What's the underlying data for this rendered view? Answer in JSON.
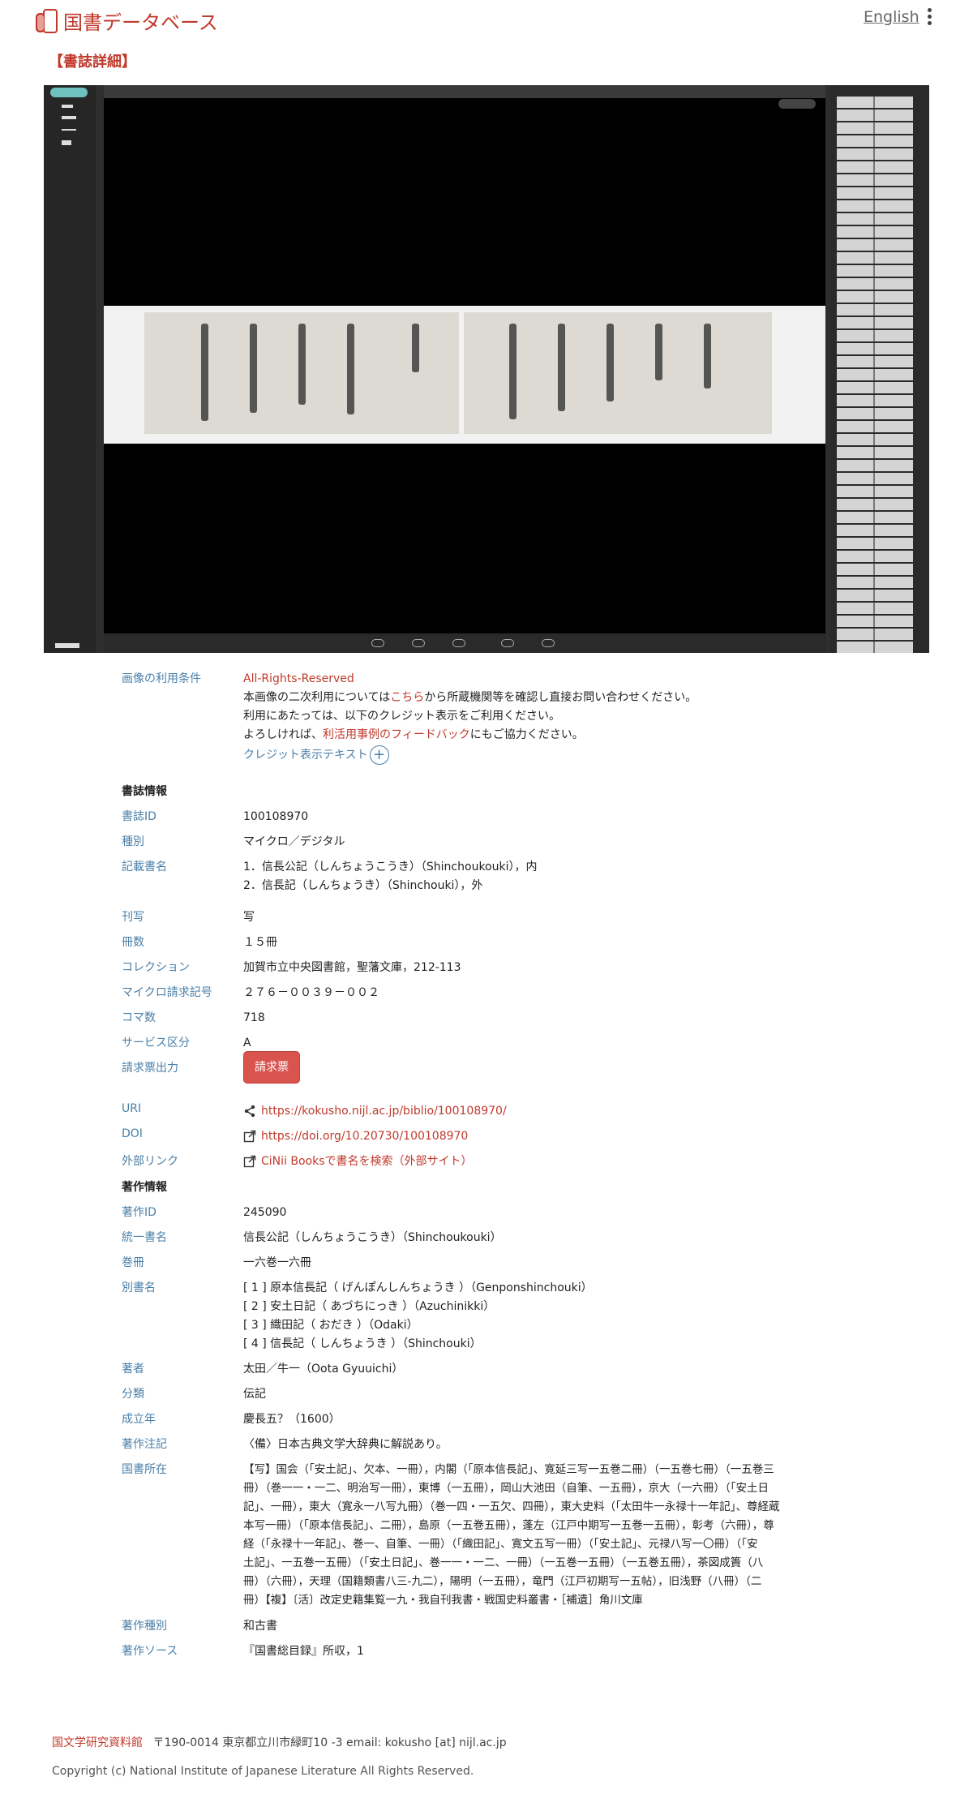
{
  "header": {
    "site_title": "国書データベース",
    "language_link": "English"
  },
  "page_heading": "【書誌詳細】",
  "image_terms": {
    "label": "画像の利用条件",
    "license": "All-Rights-Reserved",
    "line1_pre": "本画像の二次利用については",
    "line1_link": "こちら",
    "line1_post": "から所蔵機関等を確認し直接お問い合わせください。",
    "line2": "利用にあたっては、以下のクレジット表示をご利用ください。",
    "line3_pre": "よろしければ、",
    "line3_link": "利活用事例のフィードバック",
    "line3_post": "にもご協力ください。",
    "credit_toggle": "クレジット表示テキスト"
  },
  "biblio": {
    "section_title": "書誌情報",
    "id_label": "書誌ID",
    "id_value": "100108970",
    "type_label": "種別",
    "type_value": "マイクロ／デジタル",
    "titles_label": "記載書名",
    "title1": "1．信長公記（しんちょうこうき）（Shinchoukouki），内",
    "title2": "2．信長記（しんちょうき）（Shinchouki），外",
    "print_label": "刊写",
    "print_value": "写",
    "volumes_label": "冊数",
    "volumes_value": "１５冊",
    "collection_label": "コレクション",
    "collection_value": "加賀市立中央図書館，聖藩文庫，212‐113",
    "micro_label": "マイクロ請求記号",
    "micro_value": "２７６－００３９－００２",
    "frames_label": "コマ数",
    "frames_value": "718",
    "service_label": "サービス区分",
    "service_value": "A",
    "request_label": "請求票出力",
    "request_button": "請求票",
    "uri_label": "URI",
    "uri_value": "https://kokusho.nijl.ac.jp/biblio/100108970/",
    "doi_label": "DOI",
    "doi_value": "https://doi.org/10.20730/100108970",
    "ext_label": "外部リンク",
    "ext_value": "CiNii Booksで書名を検索（外部サイト）"
  },
  "work": {
    "section_title": "著作情報",
    "id_label": "著作ID",
    "id_value": "245090",
    "unified_label": "統一書名",
    "unified_value": "信長公記（しんちょうこうき）（Shinchoukouki）",
    "vol_label": "巻冊",
    "vol_value": "一六巻一六冊",
    "alt_label": "別書名",
    "alt1": "[ 1 ] 原本信長記（ げんぽんしんちょうき ）（Genponshinchouki）",
    "alt2": "[ 2 ] 安土日記（ あづちにっき ）（Azuchinikki）",
    "alt3": "[ 3 ] 織田記（ おだき ）（Odaki）",
    "alt4": "[ 4 ] 信長記（ しんちょうき ）（Shinchouki）",
    "author_label": "著者",
    "author_value": "太田／牛一（Oota Gyuuichi）",
    "class_label": "分類",
    "class_value": "伝記",
    "year_label": "成立年",
    "year_value": "慶長五？（1600）",
    "note_label": "著作注記",
    "note_value": "〈備〉日本古典文学大辞典に解説あり。",
    "loc_label": "国書所在",
    "loc_lines": [
      "【写】国会（「安土記」、欠本、一冊），内閣（「原本信長記」、寛延三写一五巻二冊）（一五巻七冊）（一五巻三",
      "冊）（巻一一・一二、明治写一冊），東博（一五冊），岡山大池田（自筆、一五冊），京大（一六冊）（「安土日",
      "記」、一冊），東大（寛永一八写九冊）（巻一四・一五欠、四冊），東大史料（「太田牛一永禄十一年記」、尊経蔵",
      "本写一冊）（「原本信長記」、二冊），島原（一五巻五冊），蓬左（江戸中期写一五巻一五冊），彰考（六冊），尊",
      "経（「永禄十一年記」、巻一、自筆、一冊）（「織田記」、寛文五写一冊）（「安土記」、元禄八写一〇冊）（「安",
      "土記」、一五巻一五冊）（「安土日記」、巻一一・一二、一冊）（一五巻一五冊）（一五巻五冊），茶図成簣（八",
      "冊）（六冊），天理（国籍類書八三‐九二），陽明（一五冊），竜門（江戸初期写一五帖），旧浅野（八冊）（二",
      "冊）【複】〔活〕改定史籍集覧一九・我自刊我書・戦国史料叢書・［補遺］角川文庫"
    ],
    "kind_label": "著作種別",
    "kind_value": "和古書",
    "source_label": "著作ソース",
    "source_value": "『国書総目録』所収，1"
  },
  "footer": {
    "org_link": "国文学研究資料館",
    "address": "〒190-0014 東京都立川市緑町10 -3  email: kokusho [at] nijl.ac.jp",
    "copyright": "Copyright (c) National Institute of Japanese Literature All Rights Reserved."
  },
  "colors": {
    "accent": "#c0392b",
    "label": "#4a7fa8",
    "button": "#d9534f"
  }
}
